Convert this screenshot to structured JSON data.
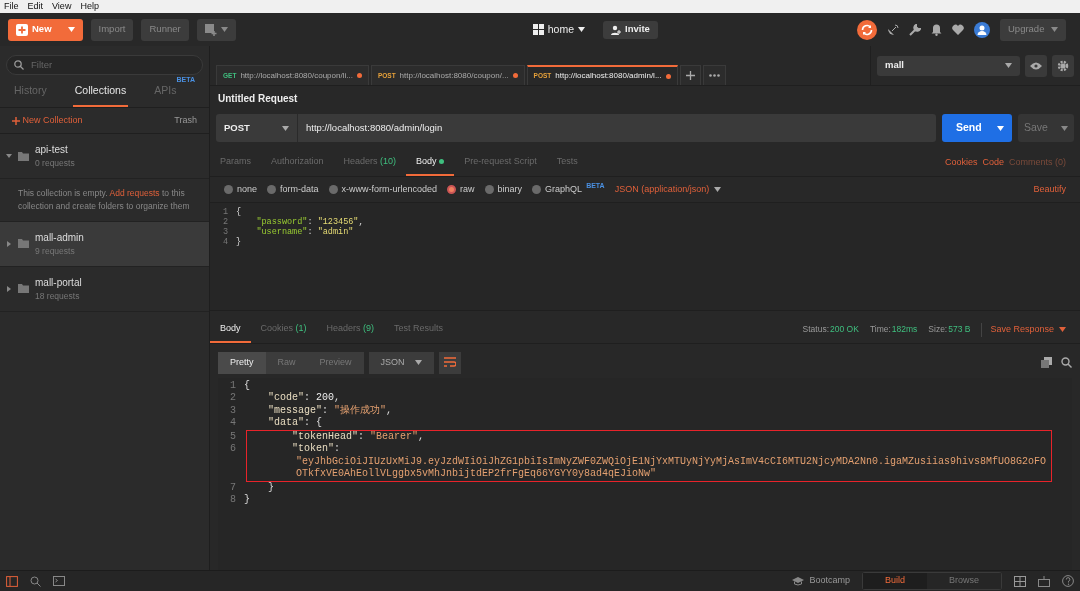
{
  "menu_bar": [
    "File",
    "Edit",
    "View",
    "Help"
  ],
  "header": {
    "new_button": "New",
    "import_button": "Import",
    "runner_button": "Runner",
    "workspace": "home",
    "invite_button": "Invite",
    "upgrade_button": "Upgrade"
  },
  "sidebar": {
    "filter_placeholder": "Filter",
    "tabs": [
      {
        "label": "History",
        "selected": false
      },
      {
        "label": "Collections",
        "selected": true
      },
      {
        "label": "APIs",
        "badge": "BETA",
        "selected": false
      }
    ],
    "new_collection": "New Collection",
    "trash": "Trash",
    "collections": [
      {
        "name": "api-test",
        "count": "0 requests",
        "expanded": true,
        "selected": false,
        "empty_before": "This collection is empty. ",
        "empty_link": "Add requests",
        "empty_after": " to this collection and create folders to organize them"
      },
      {
        "name": "mall-admin",
        "count": "9 requests",
        "expanded": false,
        "selected": true
      },
      {
        "name": "mall-portal",
        "count": "18 requests",
        "expanded": false,
        "selected": false
      }
    ]
  },
  "request_tabs": [
    {
      "method": "GET",
      "url": "http://localhost:8080/coupon/li...",
      "selected": false,
      "unsaved": true
    },
    {
      "method": "POST",
      "url": "http://localhost:8080/coupon/...",
      "selected": false,
      "unsaved": true
    },
    {
      "method": "POST",
      "url": "http://localhost:8080/admin/l...",
      "selected": true,
      "unsaved": true
    }
  ],
  "environment": "mall",
  "request": {
    "title": "Untitled Request",
    "method": "POST",
    "url": "http://localhost:8080/admin/login",
    "send_button": "Send",
    "save_button": "Save",
    "tabs": [
      {
        "label": "Params",
        "selected": false
      },
      {
        "label": "Authorization",
        "selected": false
      },
      {
        "label": "Headers",
        "count": "(10)",
        "selected": false
      },
      {
        "label": "Body",
        "dot": true,
        "selected": true
      },
      {
        "label": "Pre-request Script",
        "selected": false
      },
      {
        "label": "Tests",
        "selected": false
      }
    ],
    "links": [
      {
        "label": "Cookies",
        "disabled": false
      },
      {
        "label": "Code",
        "disabled": false
      },
      {
        "label": "Comments (0)",
        "disabled": true
      }
    ],
    "body_types": [
      {
        "label": "none",
        "selected": false
      },
      {
        "label": "form-data",
        "selected": false
      },
      {
        "label": "x-www-form-urlencoded",
        "selected": false
      },
      {
        "label": "raw",
        "selected": true
      },
      {
        "label": "binary",
        "selected": false
      },
      {
        "label": "GraphQL",
        "badge": "BETA",
        "selected": false
      }
    ],
    "format": "JSON (application/json)",
    "beautify": "Beautify",
    "code": [
      {
        "num": "1",
        "tokens": [
          {
            "kind": "punct",
            "text": "{"
          }
        ]
      },
      {
        "num": "2",
        "tokens": [
          {
            "kind": "key",
            "text": "    \"password\""
          },
          {
            "kind": "punct",
            "text": ": "
          },
          {
            "kind": "string",
            "text": "\"123456\""
          },
          {
            "kind": "punct",
            "text": ","
          }
        ]
      },
      {
        "num": "3",
        "tokens": [
          {
            "kind": "key",
            "text": "    \"username\""
          },
          {
            "kind": "punct",
            "text": ": "
          },
          {
            "kind": "string",
            "text": "\"admin\""
          }
        ]
      },
      {
        "num": "4",
        "tokens": [
          {
            "kind": "punct",
            "text": "}"
          }
        ]
      }
    ]
  },
  "response": {
    "tabs": [
      {
        "label": "Body",
        "selected": true
      },
      {
        "label": "Cookies",
        "count": "(1)",
        "selected": false
      },
      {
        "label": "Headers",
        "count": "(9)",
        "selected": false
      },
      {
        "label": "Test Results",
        "selected": false
      }
    ],
    "status": [
      {
        "label": "Status:",
        "value": "200 OK"
      },
      {
        "label": "Time:",
        "value": "182ms"
      },
      {
        "label": "Size:",
        "value": "573 B"
      }
    ],
    "save_response": "Save Response",
    "views": [
      {
        "label": "Pretty",
        "selected": true
      },
      {
        "label": "Raw",
        "selected": false
      },
      {
        "label": "Preview",
        "selected": false
      }
    ],
    "format": "JSON",
    "code": [
      {
        "num": "1",
        "tokens": [
          {
            "kind": "punct",
            "text": "{"
          }
        ]
      },
      {
        "num": "2",
        "tokens": [
          {
            "kind": "key",
            "text": "    \"code\""
          },
          {
            "kind": "punct",
            "text": ": "
          },
          {
            "kind": "number",
            "text": "200"
          },
          {
            "kind": "punct",
            "text": ","
          }
        ]
      },
      {
        "num": "3",
        "tokens": [
          {
            "kind": "key",
            "text": "    \"message\""
          },
          {
            "kind": "punct",
            "text": ": "
          },
          {
            "kind": "string",
            "text": "\"操作成功\""
          },
          {
            "kind": "punct",
            "text": ","
          }
        ]
      },
      {
        "num": "4",
        "tokens": [
          {
            "kind": "key",
            "text": "    \"data\""
          },
          {
            "kind": "punct",
            "text": ": {"
          }
        ]
      },
      {
        "num": "5",
        "highlighted": true,
        "tokens": [
          {
            "kind": "key",
            "text": "        \"tokenHead\""
          },
          {
            "kind": "punct",
            "text": ": "
          },
          {
            "kind": "string",
            "text": "\"Bearer\""
          },
          {
            "kind": "punct",
            "text": ","
          }
        ]
      },
      {
        "num": "6",
        "highlighted": true,
        "tokens": [
          {
            "kind": "key",
            "text": "        \"token\""
          },
          {
            "kind": "punct",
            "text": ":"
          }
        ]
      },
      {
        "highlighted": true,
        "tokens": [
          {
            "kind": "string",
            "text": "\"eyJhbGciOiJIUzUxMiJ9.eyJzdWIiOiJhZG1pbiIsImNyZWF0ZWQiOjE1NjYxMTUyNjYyMjAsImV4cCI6MTU2NjcyMDA2Nn0.igaMZusiias9hivs8MfUO8G2oFOOTkfxVE0AhEollVLggbx5vMhJnbijtdEP2frFgEq66YGYY0y8ad4qEJioNw\""
          }
        ]
      },
      {
        "num": "7",
        "tokens": [
          {
            "kind": "punct",
            "text": "    }"
          }
        ]
      },
      {
        "num": "8",
        "tokens": [
          {
            "kind": "punct",
            "text": "}"
          }
        ]
      }
    ]
  },
  "status_bar": {
    "bootcamp": "Bootcamp",
    "modes": [
      {
        "label": "Build",
        "selected": true
      },
      {
        "label": "Browse",
        "selected": false
      }
    ]
  }
}
